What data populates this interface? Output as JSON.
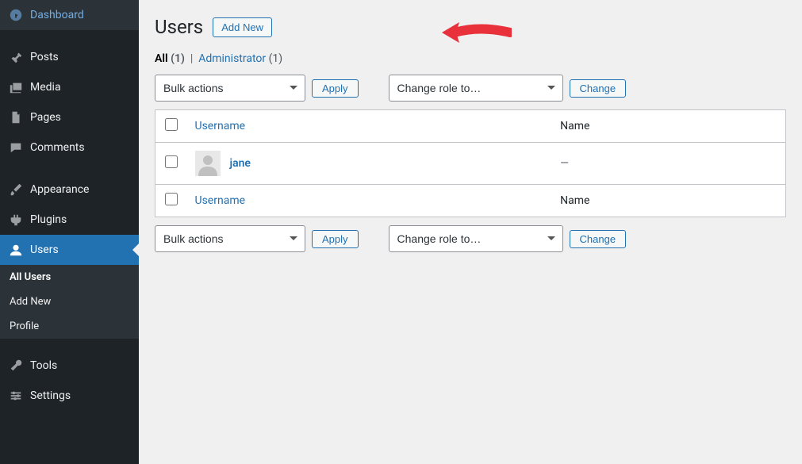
{
  "sidebar": {
    "items": [
      {
        "label": "Dashboard",
        "icon": "dashboard"
      },
      {
        "label": "Posts",
        "icon": "posts"
      },
      {
        "label": "Media",
        "icon": "media"
      },
      {
        "label": "Pages",
        "icon": "pages"
      },
      {
        "label": "Comments",
        "icon": "comments"
      },
      {
        "label": "Appearance",
        "icon": "appearance"
      },
      {
        "label": "Plugins",
        "icon": "plugins"
      },
      {
        "label": "Users",
        "icon": "users"
      },
      {
        "label": "Tools",
        "icon": "tools"
      },
      {
        "label": "Settings",
        "icon": "settings"
      }
    ],
    "submenu": [
      {
        "label": "All Users",
        "current": true
      },
      {
        "label": "Add New"
      },
      {
        "label": "Profile"
      }
    ]
  },
  "page": {
    "title": "Users",
    "add_new": "Add New"
  },
  "filters": {
    "all_label": "All",
    "all_count": "(1)",
    "sep": "|",
    "admin_label": "Administrator",
    "admin_count": "(1)"
  },
  "bulk": {
    "bulk_label": "Bulk actions",
    "apply": "Apply",
    "role_label": "Change role to…",
    "change": "Change"
  },
  "table": {
    "col_username": "Username",
    "col_name": "Name",
    "rows": [
      {
        "username": "jane",
        "name": "—"
      }
    ]
  }
}
